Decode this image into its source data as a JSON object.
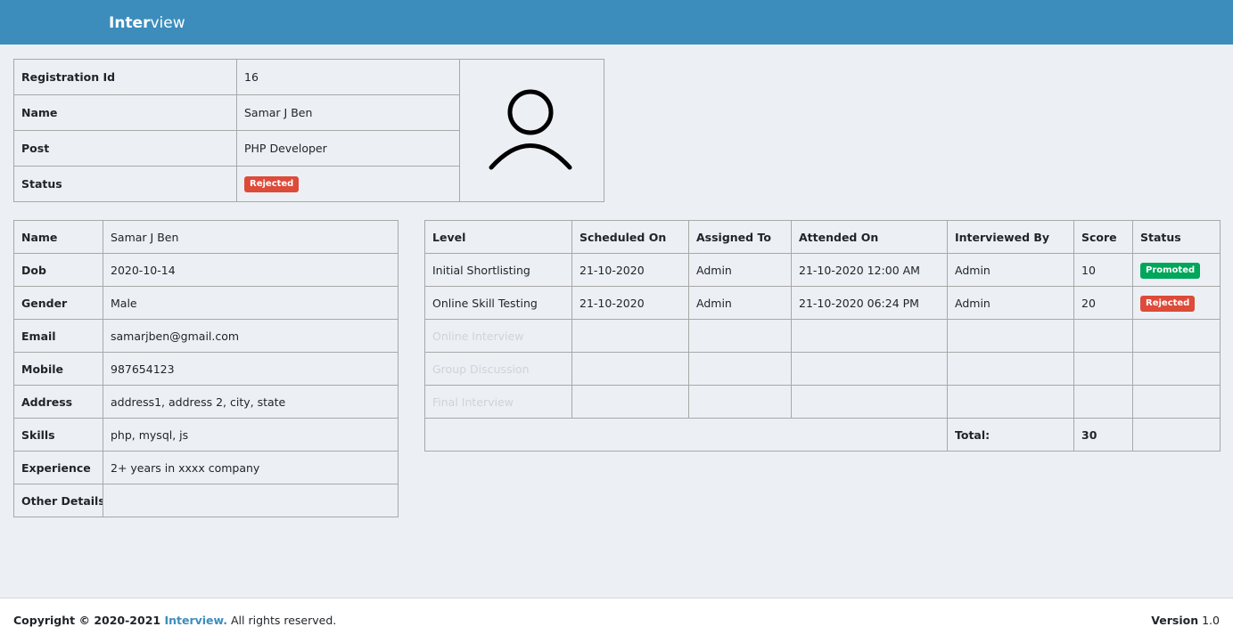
{
  "app": {
    "brand_bold": "Inter",
    "brand_light": "view"
  },
  "summary": {
    "rows": [
      {
        "label": "Registration Id",
        "value": "16"
      },
      {
        "label": "Name",
        "value": "Samar J Ben"
      },
      {
        "label": "Post",
        "value": "PHP Developer"
      },
      {
        "label": "Status",
        "value": ""
      }
    ],
    "status_badge": "Rejected"
  },
  "details": [
    {
      "label": "Name",
      "value": "Samar J Ben"
    },
    {
      "label": "Dob",
      "value": "2020-10-14"
    },
    {
      "label": "Gender",
      "value": "Male"
    },
    {
      "label": "Email",
      "value": "samarjben@gmail.com"
    },
    {
      "label": "Mobile",
      "value": "987654123"
    },
    {
      "label": "Address",
      "value": "address1, address 2, city, state"
    },
    {
      "label": "Skills",
      "value": "php, mysql, js"
    },
    {
      "label": "Experience",
      "value": "2+ years in xxxx company"
    },
    {
      "label": "Other Details",
      "value": ""
    }
  ],
  "levels": {
    "headers": [
      "Level",
      "Scheduled On",
      "Assigned To",
      "Attended On",
      "Interviewed By",
      "Score",
      "Status"
    ],
    "rows": [
      {
        "level": "Initial Shortlisting",
        "scheduled": "21-10-2020",
        "assigned": "Admin",
        "attended": "21-10-2020 12:00 AM",
        "interviewer": "Admin",
        "score": "10",
        "status": "Promoted"
      },
      {
        "level": "Online Skill Testing",
        "scheduled": "21-10-2020",
        "assigned": "Admin",
        "attended": "21-10-2020 06:24 PM",
        "interviewer": "Admin",
        "score": "20",
        "status": "Rejected"
      },
      {
        "level": "Online Interview",
        "scheduled": "",
        "assigned": "",
        "attended": "",
        "interviewer": "",
        "score": "",
        "status": ""
      },
      {
        "level": "Group Discussion",
        "scheduled": "",
        "assigned": "",
        "attended": "",
        "interviewer": "",
        "score": "",
        "status": ""
      },
      {
        "level": "Final Interview",
        "scheduled": "",
        "assigned": "",
        "attended": "",
        "interviewer": "",
        "score": "",
        "status": ""
      }
    ],
    "total_label": "Total:",
    "total_value": "30"
  },
  "footer": {
    "copyright_prefix": "Copyright © 2020-2021 ",
    "copyright_link": "Interview.",
    "copyright_suffix": " All rights reserved.",
    "version_label": "Version",
    "version_value": "1.0"
  },
  "colors": {
    "navbar": "#3c8dbc",
    "danger": "#dd4b39",
    "success": "#00a65a",
    "background": "#ecf0f5"
  },
  "icons": {
    "avatar": "user-avatar-icon"
  }
}
